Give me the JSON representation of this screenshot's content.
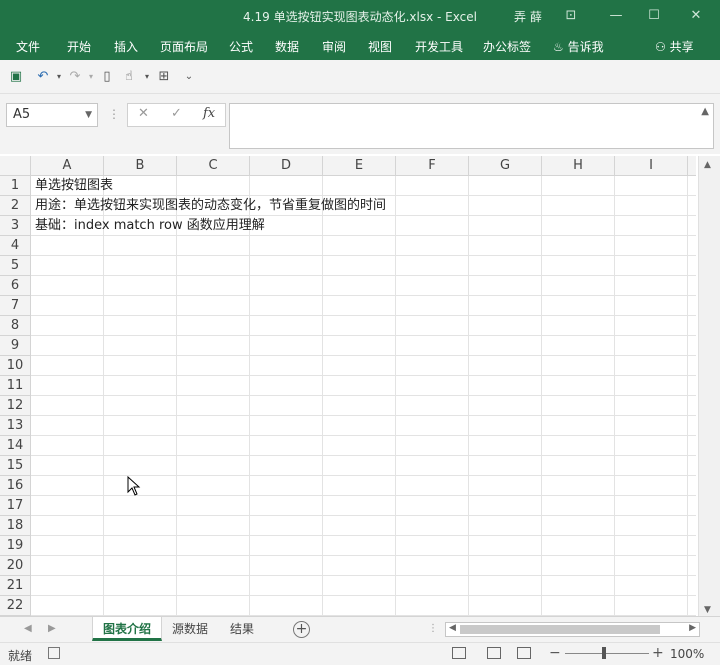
{
  "window": {
    "title": "4.19 单选按钮实现图表动态化.xlsx  -  Excel",
    "user": "弄 薛"
  },
  "ribbon": {
    "tabs": [
      "文件",
      "开始",
      "插入",
      "页面布局",
      "公式",
      "数据",
      "审阅",
      "视图",
      "开发工具",
      "办公标签"
    ],
    "tell_me": "告诉我",
    "share": "共享"
  },
  "formula_bar": {
    "name_box": "A5",
    "fx_label": "fx",
    "content": ""
  },
  "grid": {
    "columns": [
      "A",
      "B",
      "C",
      "D",
      "E",
      "F",
      "G",
      "H",
      "I"
    ],
    "rows": [
      "1",
      "2",
      "3",
      "4",
      "5",
      "6",
      "7",
      "8",
      "9",
      "10",
      "11",
      "12",
      "13",
      "14",
      "15",
      "16",
      "17",
      "18",
      "19",
      "20",
      "21",
      "22"
    ],
    "cells": [
      {
        "ref": "A1",
        "text": "单选按钮图表"
      },
      {
        "ref": "A2",
        "text": "用途：单选按钮来实现图表的动态变化，节省重复做图的时间"
      },
      {
        "ref": "A3",
        "text": "基础：index match row 函数应用理解"
      }
    ]
  },
  "sheets": {
    "tabs": [
      "图表介绍",
      "源数据",
      "结果"
    ],
    "active": "图表介绍"
  },
  "status_bar": {
    "status": "就绪",
    "zoom": "100%"
  }
}
